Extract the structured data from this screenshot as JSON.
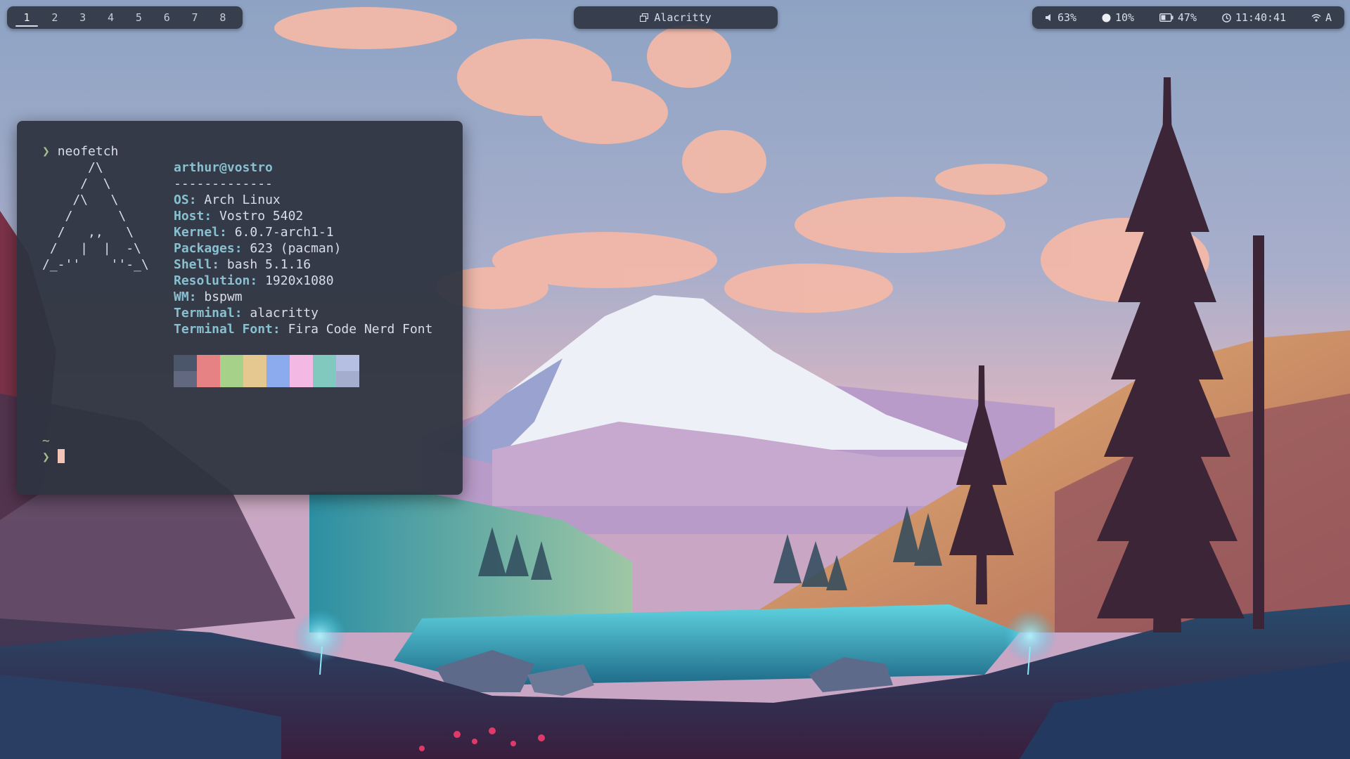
{
  "colors": {
    "bar_bg": "#2e3440",
    "terminal_bg": "#2e3440",
    "prompt": "#a3be8c",
    "label": "#88c0d0",
    "text": "#d8dee9",
    "cursor": "#f3c5b8"
  },
  "workspaces": [
    {
      "label": "1",
      "active": true
    },
    {
      "label": "2",
      "active": false
    },
    {
      "label": "3",
      "active": false
    },
    {
      "label": "4",
      "active": false
    },
    {
      "label": "5",
      "active": false
    },
    {
      "label": "6",
      "active": false
    },
    {
      "label": "7",
      "active": false
    },
    {
      "label": "8",
      "active": false
    }
  ],
  "window_title": {
    "icon": "window-icon",
    "text": "Alacritty"
  },
  "status": {
    "volume": {
      "icon": "speaker-icon",
      "text": "63%"
    },
    "cpu": {
      "icon": "circle-icon",
      "text": "10%"
    },
    "battery": {
      "icon": "battery-icon",
      "text": "47%",
      "level": 0.47
    },
    "clock": {
      "icon": "clock-icon",
      "text": "11:40:41"
    },
    "network": {
      "icon": "wifi-icon",
      "text": "A"
    }
  },
  "terminal": {
    "prompt_symbol": "❯",
    "command": "neofetch",
    "logo_lines": [
      "      /\\",
      "     /  \\",
      "    /\\   \\",
      "   /      \\",
      "  /   ,,   \\",
      " /   |  |  -\\",
      "/_-''    ''-_\\"
    ],
    "user_host": "arthur@vostro",
    "separator": "-------------",
    "info": [
      {
        "key": "OS",
        "value": "Arch Linux"
      },
      {
        "key": "Host",
        "value": "Vostro 5402"
      },
      {
        "key": "Kernel",
        "value": "6.0.7-arch1-1"
      },
      {
        "key": "Packages",
        "value": "623 (pacman)"
      },
      {
        "key": "Shell",
        "value": "bash 5.1.16"
      },
      {
        "key": "Resolution",
        "value": "1920x1080"
      },
      {
        "key": "WM",
        "value": "bspwm"
      },
      {
        "key": "Terminal",
        "value": "alacritty"
      },
      {
        "key": "Terminal Font",
        "value": "Fira Code Nerd Font"
      }
    ],
    "palette_top": [
      "#4c566a",
      "#e78284",
      "#a6d189",
      "#e5c890",
      "#8caaee",
      "#f4b8e4",
      "#81c8be",
      "#b5bfe2"
    ],
    "palette_bottom": [
      "#626880",
      "#e78284",
      "#a6d189",
      "#e5c890",
      "#8caaee",
      "#f4b8e4",
      "#81c8be",
      "#a5adce"
    ],
    "cwd": "~"
  }
}
